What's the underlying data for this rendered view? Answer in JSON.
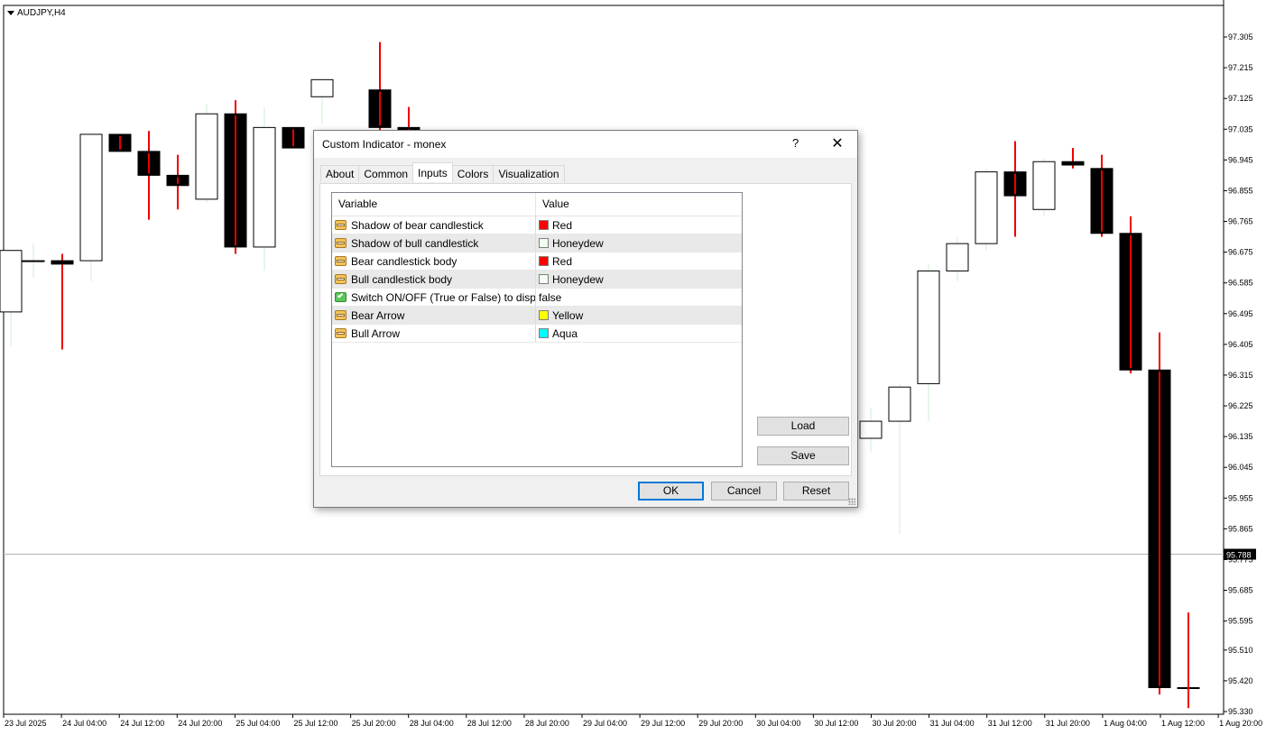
{
  "chart": {
    "symbol": "AUDJPY,H4",
    "current_price": "95.788",
    "price_levels": [
      "97.305",
      "97.215",
      "97.125",
      "97.035",
      "96.945",
      "96.855",
      "96.765",
      "96.675",
      "96.585",
      "96.495",
      "96.405",
      "96.315",
      "96.225",
      "96.135",
      "96.045",
      "95.955",
      "95.865",
      "95.775",
      "95.685",
      "95.595",
      "95.510",
      "95.420",
      "95.330"
    ],
    "time_labels": [
      "23 Jul 2025",
      "24 Jul 04:00",
      "24 Jul 12:00",
      "24 Jul 20:00",
      "25 Jul 04:00",
      "25 Jul 12:00",
      "25 Jul 20:00",
      "28 Jul 04:00",
      "28 Jul 12:00",
      "28 Jul 20:00",
      "29 Jul 04:00",
      "29 Jul 12:00",
      "29 Jul 20:00",
      "30 Jul 04:00",
      "30 Jul 12:00",
      "30 Jul 20:00",
      "31 Jul 04:00",
      "31 Jul 12:00",
      "31 Jul 20:00",
      "1 Aug 04:00",
      "1 Aug 12:00",
      "1 Aug 20:00"
    ],
    "colors": {
      "bear_body": "#000000",
      "bull_body": "#ffffff",
      "bear_shadow": "#ee0000",
      "bull_shadow": "#e8f6e8"
    }
  },
  "chart_data": {
    "type": "candlestick",
    "ylim": [
      95.33,
      97.35
    ],
    "candles": [
      {
        "o": 96.5,
        "h": 96.6,
        "l": 96.4,
        "c": 96.68,
        "bull": true
      },
      {
        "o": 96.65,
        "h": 96.7,
        "l": 96.6,
        "c": 96.65,
        "bull": true
      },
      {
        "o": 96.65,
        "h": 96.67,
        "l": 96.39,
        "c": 96.64,
        "bull": false
      },
      {
        "o": 96.65,
        "h": 97.02,
        "l": 96.59,
        "c": 97.02,
        "bull": true
      },
      {
        "o": 97.02,
        "h": 97.02,
        "l": 96.97,
        "c": 96.97,
        "bull": false
      },
      {
        "o": 96.97,
        "h": 97.03,
        "l": 96.77,
        "c": 96.9,
        "bull": false
      },
      {
        "o": 96.9,
        "h": 96.96,
        "l": 96.8,
        "c": 96.87,
        "bull": false
      },
      {
        "o": 96.83,
        "h": 97.11,
        "l": 96.82,
        "c": 97.08,
        "bull": true
      },
      {
        "o": 97.08,
        "h": 97.12,
        "l": 96.67,
        "c": 96.69,
        "bull": false
      },
      {
        "o": 96.69,
        "h": 97.1,
        "l": 96.62,
        "c": 97.04,
        "bull": true
      },
      {
        "o": 97.04,
        "h": 97.04,
        "l": 96.98,
        "c": 96.98,
        "bull": false
      },
      {
        "o": 97.13,
        "h": 97.18,
        "l": 97.05,
        "c": 97.18,
        "bull": true
      },
      {
        "o": 97.15,
        "h": 97.29,
        "l": 96.95,
        "c": 97.04,
        "bull": false
      },
      {
        "o": 97.04,
        "h": 97.1,
        "l": 96.95,
        "c": 96.98,
        "bull": false
      },
      {
        "o": 96.14,
        "h": 96.25,
        "l": 95.96,
        "c": 96.17,
        "bull": true
      },
      {
        "o": 96.13,
        "h": 96.22,
        "l": 96.09,
        "c": 96.18,
        "bull": true
      },
      {
        "o": 96.18,
        "h": 96.29,
        "l": 95.85,
        "c": 96.28,
        "bull": true
      },
      {
        "o": 96.29,
        "h": 96.64,
        "l": 96.18,
        "c": 96.62,
        "bull": true
      },
      {
        "o": 96.62,
        "h": 96.72,
        "l": 96.59,
        "c": 96.7,
        "bull": true
      },
      {
        "o": 96.7,
        "h": 96.92,
        "l": 96.68,
        "c": 96.91,
        "bull": true
      },
      {
        "o": 96.91,
        "h": 97.0,
        "l": 96.72,
        "c": 96.84,
        "bull": false
      },
      {
        "o": 96.8,
        "h": 96.95,
        "l": 96.78,
        "c": 96.94,
        "bull": true
      },
      {
        "o": 96.94,
        "h": 96.98,
        "l": 96.92,
        "c": 96.93,
        "bull": false
      },
      {
        "o": 96.92,
        "h": 96.96,
        "l": 96.72,
        "c": 96.73,
        "bull": false
      },
      {
        "o": 96.73,
        "h": 96.78,
        "l": 96.32,
        "c": 96.33,
        "bull": false
      },
      {
        "o": 96.33,
        "h": 96.44,
        "l": 95.38,
        "c": 95.4,
        "bull": false
      },
      {
        "o": 95.4,
        "h": 95.62,
        "l": 95.34,
        "c": 95.4,
        "bull": false
      }
    ]
  },
  "dialog": {
    "title": "Custom Indicator - monex",
    "help": "?",
    "close": "✕",
    "tabs": [
      "About",
      "Common",
      "Inputs",
      "Colors",
      "Visualization"
    ],
    "active_tab": "Inputs",
    "grid": {
      "headers": {
        "variable": "Variable",
        "value": "Value"
      },
      "rows": [
        {
          "variable": "Shadow of bear candlestick",
          "value": "Red",
          "type": "color",
          "color": "#ff0000"
        },
        {
          "variable": "Shadow of bull candlestick",
          "value": "Honeydew",
          "type": "color",
          "color": "#f0fff0"
        },
        {
          "variable": "Bear candlestick body",
          "value": "Red",
          "type": "color",
          "color": "#ff0000"
        },
        {
          "variable": "Bull candlestick body",
          "value": "Honeydew",
          "type": "color",
          "color": "#f0fff0"
        },
        {
          "variable": "Switch ON/OFF (True or False) to displa...",
          "value": "false",
          "type": "bool"
        },
        {
          "variable": "Bear Arrow",
          "value": "Yellow",
          "type": "color",
          "color": "#ffff00"
        },
        {
          "variable": "Bull Arrow",
          "value": "Aqua",
          "type": "color",
          "color": "#00ffff"
        }
      ]
    },
    "buttons": {
      "load": "Load",
      "save": "Save",
      "ok": "OK",
      "cancel": "Cancel",
      "reset": "Reset"
    }
  }
}
